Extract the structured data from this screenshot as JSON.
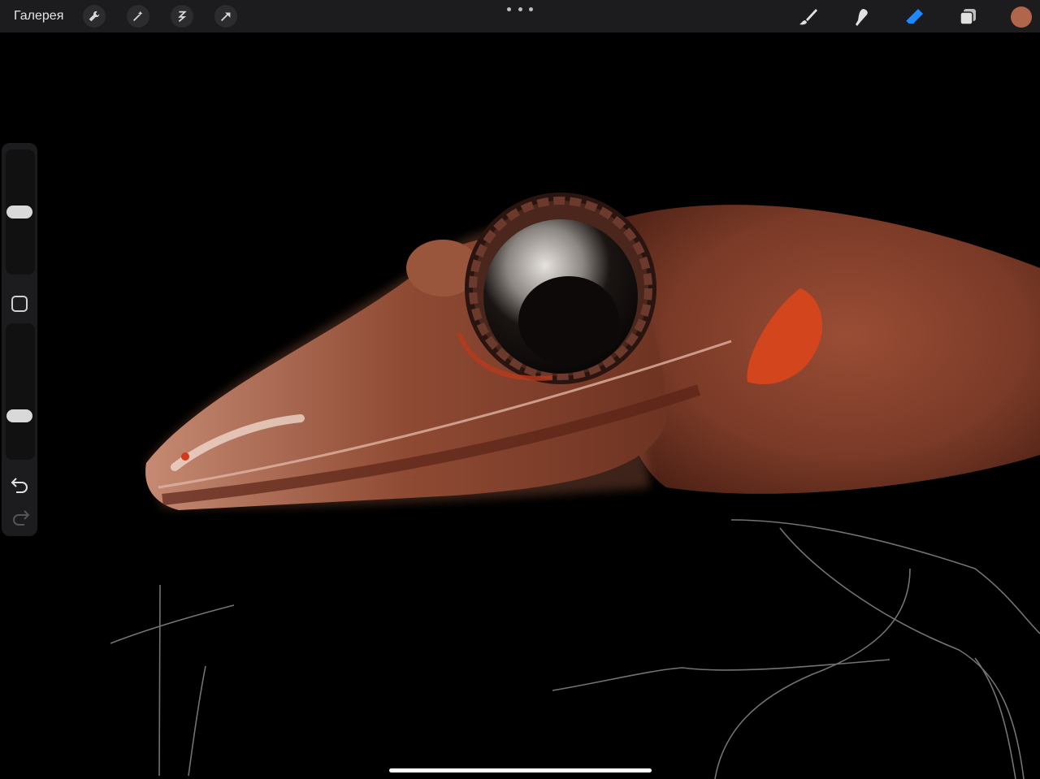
{
  "topbar": {
    "gallery_label": "Галерея",
    "left_tools": [
      {
        "icon": "wrench-icon"
      },
      {
        "icon": "magic-wand-icon"
      },
      {
        "icon": "selection-icon"
      },
      {
        "icon": "transform-arrow-icon"
      }
    ],
    "more_icon": "ellipsis-icon",
    "right_tools": [
      {
        "icon": "brush-icon",
        "active": false
      },
      {
        "icon": "smudge-icon",
        "active": false
      },
      {
        "icon": "eraser-icon",
        "active": true
      },
      {
        "icon": "layers-icon",
        "active": false
      }
    ],
    "current_color": "#b0664a"
  },
  "sidebar": {
    "brush_size_level": 0.5,
    "opacity_level": 0.3,
    "modifier_icon": "square-icon",
    "undo_icon": "undo-icon",
    "redo_icon": "redo-icon"
  },
  "colors": {
    "accent": "#1e88ff",
    "bar": "#1c1c1e",
    "canvas": "#000000",
    "skin": "#8a4330"
  }
}
